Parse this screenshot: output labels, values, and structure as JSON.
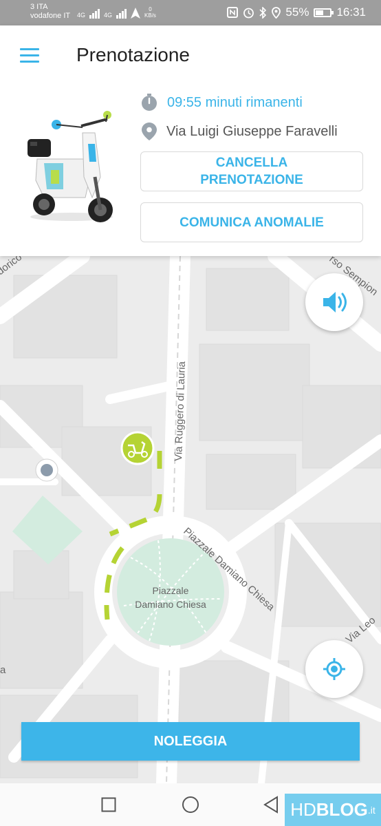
{
  "status_bar": {
    "carrier_line1": "3 ITA",
    "carrier_line2": "vodafone IT",
    "network1": "4G",
    "network2": "4G",
    "speed_value": "0",
    "speed_unit": "KB/s",
    "battery_percent": "55%",
    "battery_level": 0.55,
    "time": "16:31"
  },
  "header": {
    "title": "Prenotazione",
    "menu_icon": "hamburger-menu-icon"
  },
  "reservation": {
    "timer_text": "09:55 minuti rimanenti",
    "address_text": "Via Luigi Giuseppe Faravelli",
    "cancel_line1": "CANCELLA",
    "cancel_line2": "PRENOTAZIONE",
    "report_label": "COMUNICA ANOMALIE"
  },
  "map": {
    "streets": {
      "teodorico": "dorico",
      "sempione": "rso Sempion",
      "ruggero": "Via Ruggero di Lauria",
      "damiano_chiesa": "Piazzale Damiano Chiesa",
      "via_leo": "Via Leo",
      "left_edge": "a"
    },
    "piazza_line1": "Piazzale",
    "piazza_line2": "Damiano Chiesa",
    "colors": {
      "road": "#ffffff",
      "block": "#e4e4e4",
      "park": "#d3ecdf",
      "route": "#b5d334",
      "accent": "#3ab4e8"
    }
  },
  "actions": {
    "rent_label": "NOLEGGIA"
  },
  "watermark": {
    "hd": "HD",
    "blog": "BLOG",
    "suffix": ".it"
  }
}
